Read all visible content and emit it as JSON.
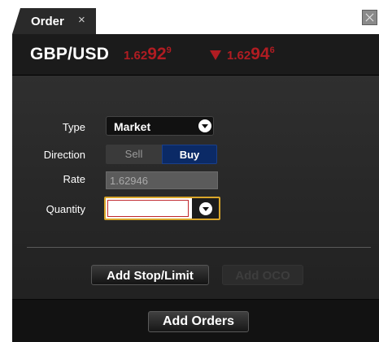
{
  "tab": {
    "title": "Order",
    "close_glyph": "×"
  },
  "window": {
    "close_icon": "close-icon"
  },
  "header": {
    "pair": "GBP/USD",
    "bid": {
      "prefix": "1.62",
      "big": "92",
      "pip": "9"
    },
    "ask": {
      "prefix": "1.62",
      "big": "94",
      "pip": "6"
    },
    "direction_icon": "down-arrow-icon",
    "price_color": "#b01c22"
  },
  "form": {
    "type": {
      "label": "Type",
      "value": "Market"
    },
    "direction": {
      "label": "Direction",
      "options": [
        "Sell",
        "Buy"
      ],
      "selected": "Buy"
    },
    "rate": {
      "label": "Rate",
      "value": "1.62946"
    },
    "quantity": {
      "label": "Quantity",
      "value": ""
    }
  },
  "buttons": {
    "stop_limit": "Add Stop/Limit",
    "oco": "Add OCO",
    "add_orders": "Add Orders"
  },
  "colors": {
    "buy_selected": "#0b2a66",
    "focus_border": "#d9a62a"
  }
}
